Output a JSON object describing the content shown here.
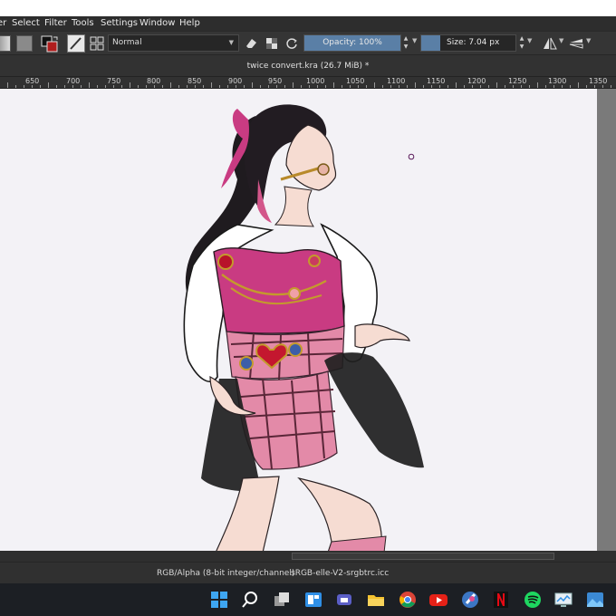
{
  "menubar": {
    "items": [
      "er",
      "Select",
      "Filter",
      "Tools",
      "Settings",
      "Window",
      "Help"
    ]
  },
  "toolbar": {
    "blend_mode": "Normal",
    "opacity_label": "Opacity: 100%",
    "size_label": "Size: 7.04 px"
  },
  "document": {
    "title": "twice convert.kra (26.7 MiB) *"
  },
  "ruler": {
    "labels": [
      "650",
      "700",
      "750",
      "800",
      "850",
      "900",
      "950",
      "1000",
      "1050",
      "1100",
      "1150",
      "1200",
      "1250",
      "1300",
      "1350"
    ]
  },
  "status": {
    "color_model": "RGB/Alpha (8-bit integer/channel)",
    "color_profile": "sRGB-elle-V2-srgbtrc.icc"
  },
  "colors": {
    "accent": "#5a7fa6",
    "dress_pink": "#c93b82",
    "skirt_black": "#1e1e1e",
    "canvas_bg": "#f3f2f6"
  },
  "taskbar": {
    "icons": [
      "windows-start-icon",
      "search-icon",
      "task-view-icon",
      "widgets-icon",
      "teams-icon",
      "file-explorer-icon",
      "chrome-icon",
      "youtube-icon",
      "krita-icon",
      "netflix-icon",
      "spotify-icon",
      "monitor-icon",
      "photos-icon"
    ]
  }
}
